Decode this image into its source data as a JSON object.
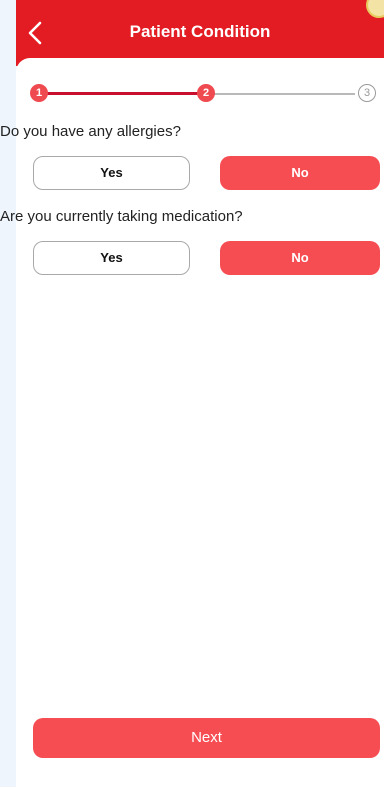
{
  "header": {
    "title": "Patient Condition",
    "back_icon": "chevron-left-icon"
  },
  "stepper": {
    "steps": [
      {
        "label": "1",
        "state": "completed"
      },
      {
        "label": "2",
        "state": "active"
      },
      {
        "label": "3",
        "state": "pending"
      }
    ]
  },
  "questions": [
    {
      "text": "Do you have any allergies?",
      "yes_label": "Yes",
      "no_label": "No",
      "selected": "No"
    },
    {
      "text": "Are you currently taking medication?",
      "yes_label": "Yes",
      "no_label": "No",
      "selected": "No"
    }
  ],
  "footer": {
    "next_label": "Next"
  },
  "colors": {
    "brand_red": "#e31b23",
    "selected_button": "#f64d53",
    "background": "#eef5fd"
  }
}
